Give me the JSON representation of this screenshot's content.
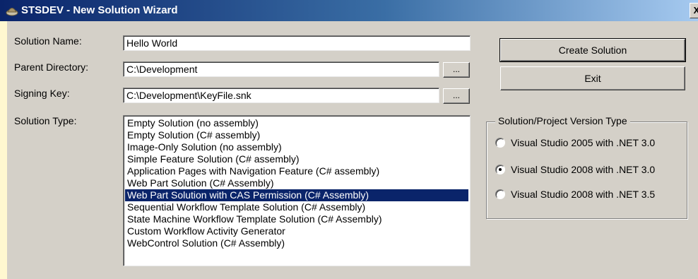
{
  "window": {
    "title": "STSDEV - New Solution Wizard",
    "close_label": "X"
  },
  "form": {
    "solution_name_label": "Solution Name:",
    "solution_name_value": "Hello World",
    "parent_directory_label": "Parent Directory:",
    "parent_directory_value": "C:\\Development",
    "signing_key_label": "Signing Key:",
    "signing_key_value": "C:\\Development\\KeyFile.snk",
    "browse_label": "...",
    "solution_type_label": "Solution Type:"
  },
  "solution_types": {
    "items": [
      "Empty Solution (no assembly)",
      "Empty Solution (C# assembly)",
      "Image-Only Solution (no assembly)",
      "Simple Feature Solution (C# assembly)",
      "Application Pages with Navigation Feature (C# assembly)",
      "Web Part Solution (C# Assembly)",
      "Web Part Solution with CAS Permission (C# Assembly)",
      "Sequential Workflow Template Solution (C# Assembly)",
      "State Machine Workflow Template Solution (C# Assembly)",
      "Custom Workflow Activity Generator",
      "WebControl Solution (C# Assembly)"
    ],
    "selected": "Web Part Solution with CAS Permission (C# Assembly)"
  },
  "buttons": {
    "create_label": "Create Solution",
    "exit_label": "Exit"
  },
  "version_group": {
    "legend": "Solution/Project Version Type",
    "options": [
      "Visual Studio 2005 with .NET 3.0",
      "Visual Studio 2008 with .NET 3.0",
      "Visual Studio 2008 with .NET 3.5"
    ],
    "selected": "Visual Studio 2008 with .NET 3.0"
  },
  "colors": {
    "selection": "#0a246a",
    "dialog_bg": "#d4d0c8"
  }
}
